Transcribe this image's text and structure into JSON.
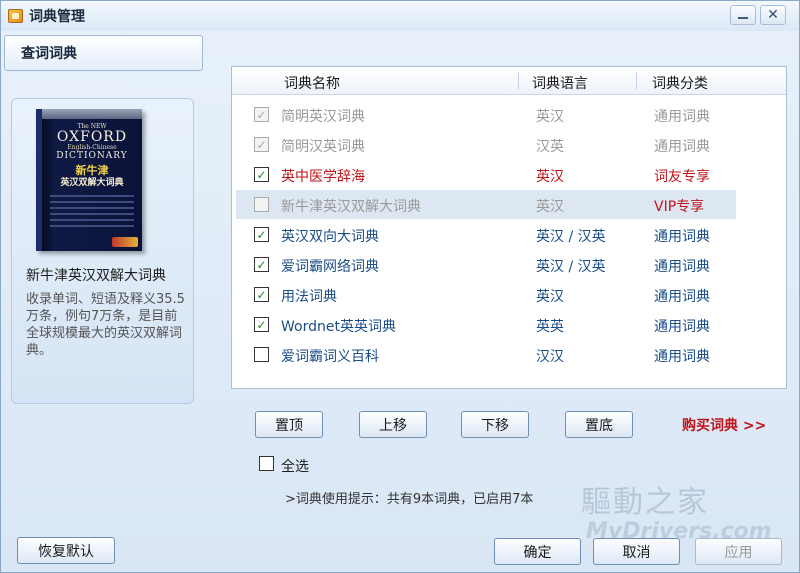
{
  "window": {
    "title": "词典管理"
  },
  "left": {
    "tab_label": "查词词典",
    "book_cover": {
      "the_new": "The NEW",
      "oxford": "OXFORD",
      "english_chinese": "English-Chinese",
      "dictionary": "DICTIONARY",
      "cn_title_1": "新牛津",
      "cn_title_2": "英汉双解大词典"
    },
    "book_name": "新牛津英汉双解大词典",
    "book_desc": "收录单词、短语及释义35.5万条，例句7万条，是目前全球规模最大的英汉双解词典。"
  },
  "table": {
    "headers": {
      "name": "词典名称",
      "lang": "词典语言",
      "type": "词典分类"
    },
    "rows": [
      {
        "checked": true,
        "disabled": true,
        "name": "简明英汉词典",
        "lang": "英汉",
        "type": "通用词典",
        "color": "gray"
      },
      {
        "checked": true,
        "disabled": true,
        "name": "简明汉英词典",
        "lang": "汉英",
        "type": "通用词典",
        "color": "gray"
      },
      {
        "checked": true,
        "disabled": false,
        "name": "英中医学辞海",
        "lang": "英汉",
        "type": "词友专享",
        "color": "red"
      },
      {
        "checked": false,
        "disabled": true,
        "name": "新牛津英汉双解大词典",
        "lang": "英汉",
        "type": "VIP专享",
        "color": "gray",
        "type_color": "red",
        "highlight": true
      },
      {
        "checked": true,
        "disabled": false,
        "name": "英汉双向大词典",
        "lang": "英汉 / 汉英",
        "type": "通用词典",
        "color": "blue"
      },
      {
        "checked": true,
        "disabled": false,
        "name": "爱词霸网络词典",
        "lang": "英汉 / 汉英",
        "type": "通用词典",
        "color": "blue"
      },
      {
        "checked": true,
        "disabled": false,
        "name": "用法词典",
        "lang": "英汉",
        "type": "通用词典",
        "color": "blue"
      },
      {
        "checked": true,
        "disabled": false,
        "name": "Wordnet英英词典",
        "lang": "英英",
        "type": "通用词典",
        "color": "blue"
      },
      {
        "checked": false,
        "disabled": false,
        "name": "爱词霸词义百科",
        "lang": "汉汉",
        "type": "通用词典",
        "color": "blue"
      }
    ]
  },
  "actions": {
    "top": "置顶",
    "up": "上移",
    "down": "下移",
    "bottom": "置底",
    "buy": "购买词典 >>"
  },
  "select_all": {
    "label": "全选",
    "checked": false
  },
  "hint": ">词典使用提示：共有9本词典，已启用7本",
  "footer": {
    "restore": "恢复默认",
    "ok": "确定",
    "cancel": "取消",
    "apply": "应用"
  },
  "watermark": {
    "text": "驅動之家",
    "url": "MyDrivers.com"
  },
  "icons": {
    "app": "dictionary-app-icon",
    "minimize": "minimize-icon",
    "close": "close-icon",
    "check": "checkmark-icon"
  }
}
